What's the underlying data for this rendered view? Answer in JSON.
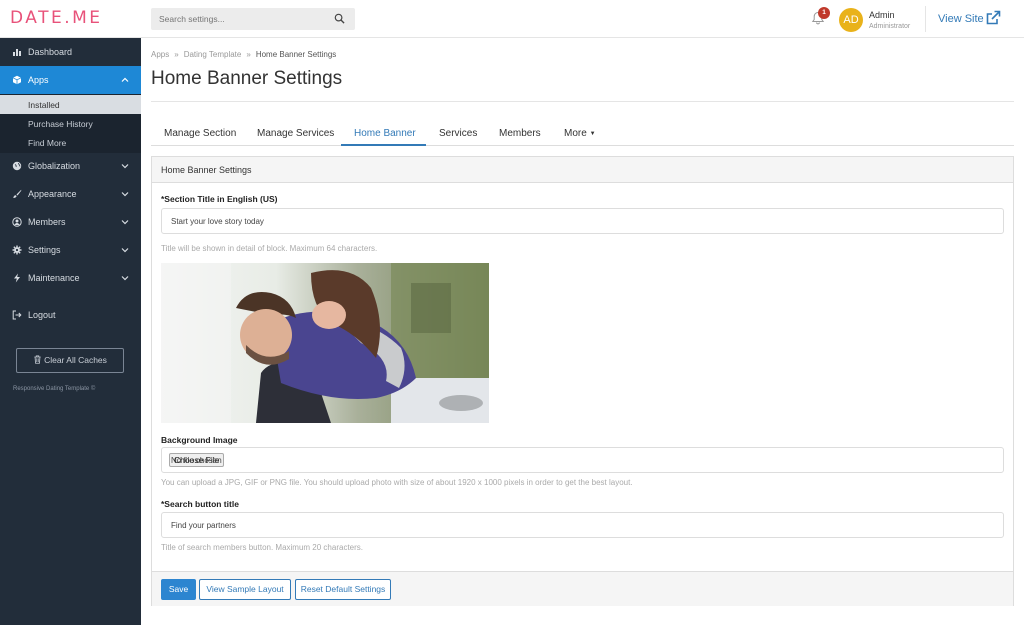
{
  "app": {
    "logo": "DATE.ME"
  },
  "topbar": {
    "search_placeholder": "Search settings...",
    "notification_count": "1",
    "user": {
      "initials": "AD",
      "name": "Admin",
      "role": "Administrator"
    },
    "view_site_label": "View Site"
  },
  "sidebar": {
    "items": [
      {
        "label": "Dashboard",
        "icon": "bar-chart-icon"
      },
      {
        "label": "Apps",
        "icon": "cube-icon"
      },
      {
        "label": "Globalization",
        "icon": "globe-icon"
      },
      {
        "label": "Appearance",
        "icon": "brush-icon"
      },
      {
        "label": "Members",
        "icon": "user-circle-icon"
      },
      {
        "label": "Settings",
        "icon": "cog-icon"
      },
      {
        "label": "Maintenance",
        "icon": "bolt-icon"
      },
      {
        "label": "Logout",
        "icon": "logout-icon"
      }
    ],
    "sub_items": [
      "Installed",
      "Purchase History",
      "Find More"
    ],
    "clear_caches_label": "Clear All Caches",
    "copyright": "Responsive Dating Template ©",
    "active_color": "#1e88d6",
    "background_color": "#222d3a"
  },
  "breadcrumb": [
    "Apps",
    "Dating Template",
    "Home Banner Settings"
  ],
  "page_title": "Home Banner Settings",
  "tabs": [
    "Manage Section",
    "Manage Services",
    "Home Banner",
    "Services",
    "Members",
    "More"
  ],
  "active_tab": "Home Banner",
  "panel": {
    "heading": "Home Banner Settings",
    "section_title_label": "*Section Title in English (US)",
    "section_title_value": "Start your love story today",
    "section_title_help": "Title will be shown in detail of block. Maximum 64 characters.",
    "background_label": "Background Image",
    "choose_file_label": "Choose File",
    "no_file_text": "No file chosen",
    "upload_help": "You can upload a JPG, GIF or PNG file. You should upload photo with size of about 1920 x 1000 pixels in order to get the best layout.",
    "search_button_label": "*Search button title",
    "search_button_value": "Find your partners",
    "search_button_help": "Title of search members button. Maximum 20 characters."
  },
  "actions": {
    "save": "Save",
    "view_sample": "View Sample Layout",
    "reset": "Reset Default Settings"
  },
  "colors": {
    "brand": "#e8527a",
    "primary": "#2c85d0",
    "link": "#337ab7",
    "badge": "#c0392b",
    "avatar": "#e9b21a"
  }
}
